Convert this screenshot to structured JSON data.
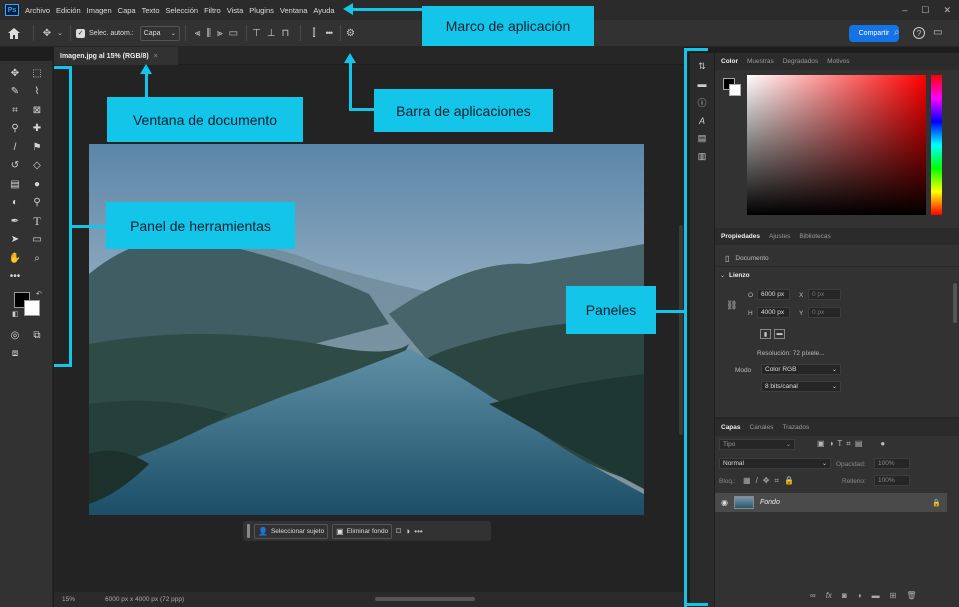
{
  "menu": {
    "items": [
      "Archivo",
      "Edición",
      "Imagen",
      "Capa",
      "Texto",
      "Selección",
      "Filtro",
      "Vista",
      "Plugins",
      "Ventana",
      "Ayuda"
    ],
    "window_controls": [
      "–",
      "☐",
      "✕"
    ]
  },
  "options": {
    "auto_select_label": "Selec. autom.:",
    "auto_select_value": "Capa",
    "more": "•••",
    "share_label": "Compartir"
  },
  "document": {
    "tab_title": "Imagen.jpg al 15% (RGB/8)",
    "tab_close": "×"
  },
  "context_bar": {
    "select_subject": "Seleccionar sujeto",
    "remove_bg": "Eliminar fondo",
    "more": "•••"
  },
  "status": {
    "zoom": "15%",
    "size": "6000 px x 4000 px (72 ppp)"
  },
  "color_panel": {
    "tabs": [
      "Color",
      "Muestras",
      "Degradados",
      "Motivos"
    ]
  },
  "properties_panel": {
    "tabs": [
      "Propiedades",
      "Ajustes",
      "Bibliotecas"
    ],
    "doc_label": "Documento",
    "section": "Lienzo",
    "w_label": "O",
    "w_value": "6000 px",
    "h_label": "H",
    "h_value": "4000 px",
    "x_label": "X",
    "x_value": "0 px",
    "y_label": "Y",
    "y_value": "0 px",
    "resolution": "Resolución: 72 píxele...",
    "mode_label": "Modo",
    "mode_value": "Color RGB",
    "depth_value": "8 bits/canal"
  },
  "layers_panel": {
    "tabs": [
      "Capas",
      "Canales",
      "Trazados"
    ],
    "filter_value": "Tipo",
    "blend_mode": "Normal",
    "opacity_label": "Opacidad:",
    "opacity_value": "100%",
    "lock_label": "Bloq.:",
    "fill_label": "Relleno:",
    "fill_value": "100%",
    "layer_name": "Fondo"
  },
  "annotations": {
    "app_frame": "Marco de aplicación",
    "app_bar": "Barra de aplicaciones",
    "doc_window": "Ventana de documento",
    "tools_panel": "Panel de herramientas",
    "panels": "Paneles"
  },
  "colors": {
    "accent": "#14c5ea",
    "share": "#1473e6",
    "ui_dark": "#323232"
  }
}
